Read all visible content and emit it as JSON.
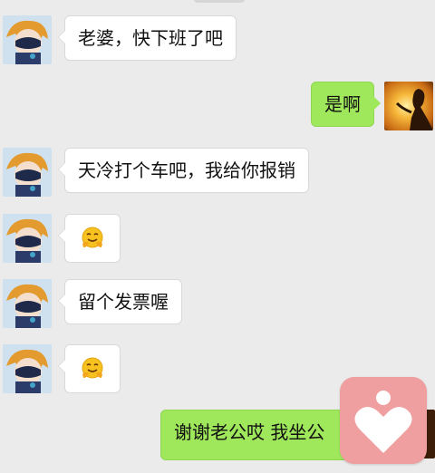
{
  "messages": [
    {
      "side": "in",
      "text": "老婆，快下班了吧"
    },
    {
      "side": "out",
      "text": "是啊"
    },
    {
      "side": "in",
      "text": "天冷打个车吧，我给你报销"
    },
    {
      "side": "in",
      "emoji": "hugging-face-emoji"
    },
    {
      "side": "in",
      "text": "留个发票喔"
    },
    {
      "side": "in",
      "emoji": "hugging-face-emoji"
    },
    {
      "side": "out",
      "text": "谢谢老公哎  我坐公"
    }
  ],
  "colors": {
    "background": "#ebebeb",
    "incoming_bubble": "#ffffff",
    "outgoing_bubble": "#9fe75b",
    "heart_badge": "#ef9fa0"
  },
  "icons": {
    "contact_avatar": "cartoon-character-avatar",
    "self_avatar": "sunset-silhouette-avatar",
    "overlay": "heart-person-icon"
  }
}
